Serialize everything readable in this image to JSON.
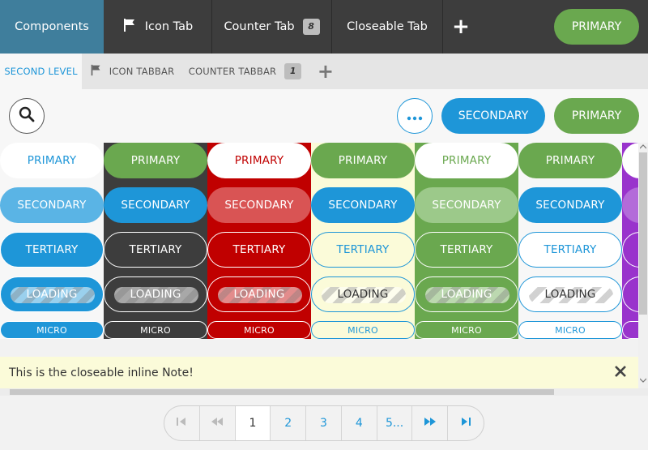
{
  "top_tabs": [
    {
      "label": "Components"
    },
    {
      "label": "Icon Tab"
    },
    {
      "label": "Counter Tab",
      "count": "8"
    },
    {
      "label": "Closeable Tab"
    },
    {
      "label": "+"
    }
  ],
  "top_primary_label": "PRIMARY",
  "second_tabs": [
    {
      "label": "SECOND LEVEL"
    },
    {
      "label": "ICON TABBAR"
    },
    {
      "label": "COUNTER TABBAR",
      "count": "1"
    },
    {
      "label": "+"
    }
  ],
  "toolbar": {
    "secondary_label": "SECONDARY",
    "primary_label": "PRIMARY"
  },
  "columns": [
    {
      "primary": "PRIMARY",
      "secondary": "SECONDARY",
      "tertiary": "TERTIARY",
      "loading": "LOADING",
      "micro": "MICRO"
    },
    {
      "primary": "PRIMARY",
      "secondary": "SECONDARY",
      "tertiary": "TERTIARY",
      "loading": "LOADING",
      "micro": "MICRO"
    },
    {
      "primary": "PRIMARY",
      "secondary": "SECONDARY",
      "tertiary": "TERTIARY",
      "loading": "LOADING",
      "micro": "MICRO"
    },
    {
      "primary": "PRIMARY",
      "secondary": "SECONDARY",
      "tertiary": "TERTIARY",
      "loading": "LOADING",
      "micro": "MICRO"
    },
    {
      "primary": "PRIMARY",
      "secondary": "SECONDARY",
      "tertiary": "TERTIARY",
      "loading": "LOADING",
      "micro": "MICRO"
    },
    {
      "primary": "PRIMARY",
      "secondary": "SECONDARY",
      "tertiary": "TERTIARY",
      "loading": "LOADING",
      "micro": "MICRO"
    }
  ],
  "note": {
    "text": "This is the closeable inline Note!"
  },
  "pager": {
    "first": "first-page-icon",
    "prev": "previous-pages-icon",
    "pages": [
      "1",
      "2",
      "3",
      "4",
      "5..."
    ],
    "current": "1",
    "next": "next-pages-icon",
    "last": "last-page-icon"
  },
  "colors": {
    "blue": "#1e96d8",
    "green": "#6aa84f",
    "red": "#c00000",
    "dark": "#3d3d3d",
    "purple": "#9933cc",
    "note_bg": "#fbfbd9"
  }
}
